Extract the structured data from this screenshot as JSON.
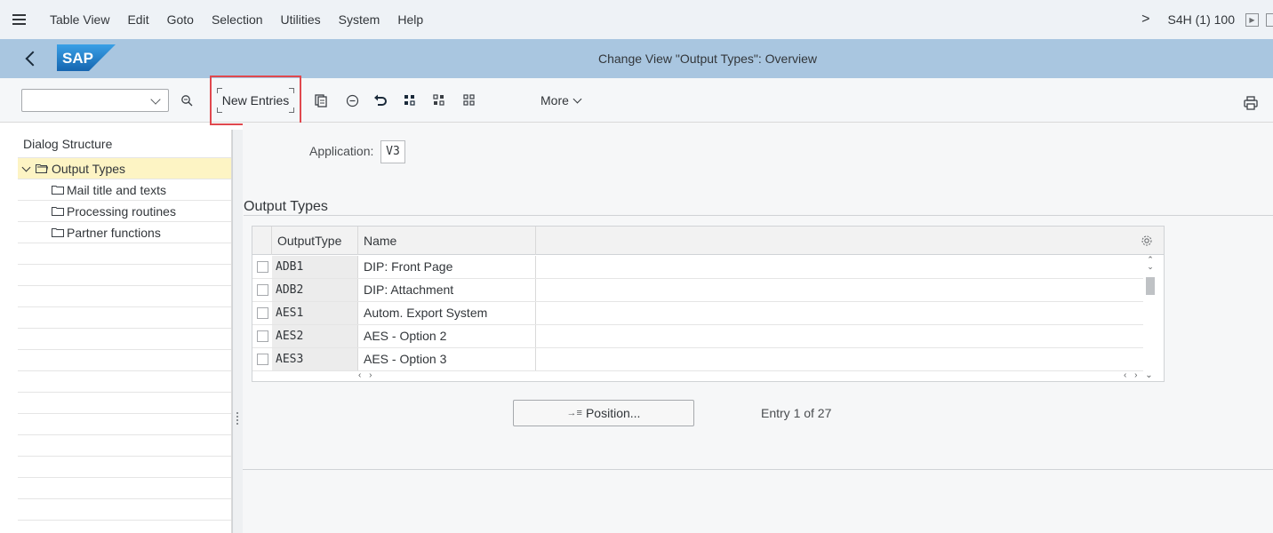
{
  "menubar": {
    "items": [
      {
        "label": "Table View"
      },
      {
        "label": "Edit"
      },
      {
        "label": "Goto"
      },
      {
        "label": "Selection"
      },
      {
        "label": "Utilities"
      },
      {
        "label": "System"
      },
      {
        "label": "Help"
      }
    ],
    "system_id": "S4H (1) 100"
  },
  "titlebar": {
    "logo_text": "SAP",
    "title": "Change View \"Output Types\": Overview"
  },
  "toolbar": {
    "command_value": "",
    "new_entries_label": "New Entries",
    "more_label": "More"
  },
  "dialog_structure": {
    "header": "Dialog Structure",
    "items": [
      {
        "label": "Output Types",
        "selected": true
      },
      {
        "label": "Mail title and texts"
      },
      {
        "label": "Processing routines"
      },
      {
        "label": "Partner functions"
      }
    ]
  },
  "main": {
    "application_label": "Application:",
    "application_value": "V3",
    "section_title": "Output Types",
    "table": {
      "columns": [
        "OutputType",
        "Name"
      ],
      "rows": [
        {
          "key": "ADB1",
          "name": "DIP: Front Page"
        },
        {
          "key": "ADB2",
          "name": "DIP: Attachment"
        },
        {
          "key": "AES1",
          "name": "Autom. Export System"
        },
        {
          "key": "AES2",
          "name": "AES - Option 2"
        },
        {
          "key": "AES3",
          "name": "AES - Option 3"
        }
      ]
    },
    "position_button": "Position...",
    "entry_text": "Entry 1 of 27"
  },
  "colors": {
    "titlebar": "#a9c6e0",
    "highlight_box": "#e0484e",
    "selected_row": "#fdf4c4",
    "sap_logo_blue": "#1d79c2"
  }
}
